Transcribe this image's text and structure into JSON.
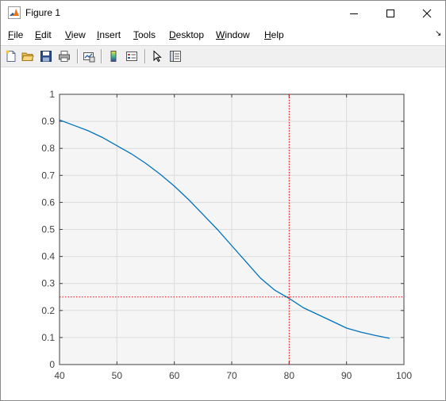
{
  "window": {
    "title": "Figure 1"
  },
  "menu": [
    {
      "key": "F",
      "rest": "ile"
    },
    {
      "key": "E",
      "rest": "dit"
    },
    {
      "key": "V",
      "rest": "iew"
    },
    {
      "key": "I",
      "rest": "nsert"
    },
    {
      "key": "T",
      "rest": "ools"
    },
    {
      "key": "D",
      "rest": "esktop"
    },
    {
      "key": "W",
      "rest": "indow"
    },
    {
      "key": "H",
      "rest": "elp"
    }
  ],
  "toolbar": {
    "icons": [
      "new-figure-icon",
      "open-file-icon",
      "save-icon",
      "print-icon",
      "link-plot-icon",
      "colorbar-icon",
      "legend-icon",
      "pointer-icon",
      "property-inspector-icon"
    ]
  },
  "chart_data": {
    "type": "line",
    "title": "",
    "xlabel": "",
    "ylabel": "",
    "xlim": [
      40,
      100
    ],
    "ylim": [
      0,
      1
    ],
    "xticks": [
      40,
      50,
      60,
      70,
      80,
      90,
      100
    ],
    "yticks": [
      0,
      0.1,
      0.2,
      0.3,
      0.4,
      0.5,
      0.6,
      0.7,
      0.8,
      0.9,
      1
    ],
    "grid": true,
    "series": [
      {
        "color": "#0072bd",
        "x": [
          40,
          42.5,
          45,
          47.5,
          50,
          52.5,
          55,
          57.5,
          60,
          62.5,
          65,
          67.5,
          70,
          72.5,
          75,
          77.5,
          80,
          82.5,
          85,
          87.5,
          90,
          92.5,
          95,
          97.5
        ],
        "y": [
          0.905,
          0.885,
          0.865,
          0.84,
          0.81,
          0.78,
          0.745,
          0.705,
          0.66,
          0.61,
          0.555,
          0.5,
          0.44,
          0.38,
          0.32,
          0.275,
          0.245,
          0.21,
          0.185,
          0.16,
          0.135,
          0.12,
          0.108,
          0.097
        ]
      }
    ],
    "reference_lines": [
      {
        "orientation": "vertical",
        "value": 80,
        "color": "#ff0000",
        "style": "dotted"
      },
      {
        "orientation": "horizontal",
        "value": 0.25,
        "color": "#ff0000",
        "style": "dotted"
      }
    ],
    "colors": {
      "axes_bg": "#f5f5f5",
      "grid": "#dcdcdc",
      "axis": "#404040"
    }
  }
}
